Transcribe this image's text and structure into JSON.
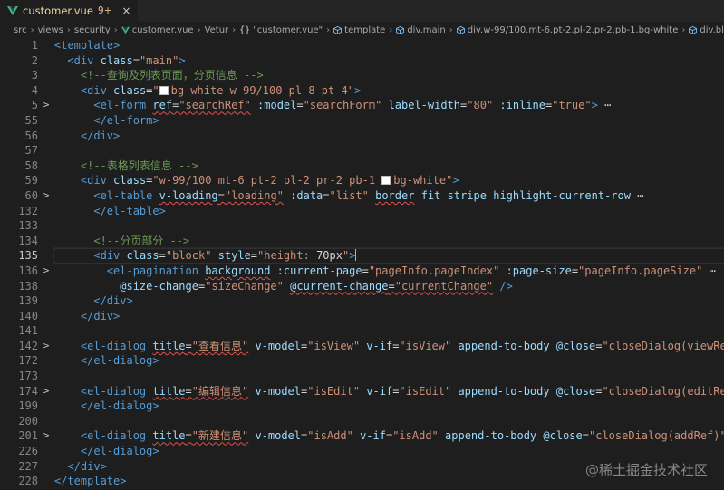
{
  "tab": {
    "filename": "customer.vue",
    "badge": "9+",
    "close": "×"
  },
  "breadcrumb": [
    "src",
    "views",
    "security",
    "customer.vue",
    "Vetur",
    "\"customer.vue\"",
    "template",
    "div.main",
    "div.w-99/100.mt-6.pt-2.pl-2.pr-2.pb-1.bg-white",
    "div.block"
  ],
  "watermark": "@稀土掘金技术社区",
  "lines": [
    {
      "n": "1",
      "fold": "",
      "tokens": [
        [
          "tag",
          "<template>"
        ]
      ]
    },
    {
      "n": "2",
      "fold": "",
      "tokens": [
        [
          "ws",
          "  "
        ],
        [
          "tag",
          "<div"
        ],
        [
          "ws",
          " "
        ],
        [
          "attr",
          "class"
        ],
        [
          "txt",
          "="
        ],
        [
          "str",
          "\"main\""
        ],
        [
          "tag",
          ">"
        ]
      ]
    },
    {
      "n": "3",
      "fold": "",
      "tokens": [
        [
          "ws",
          "    "
        ],
        [
          "cmt",
          "<!--查询及列表页面，分页信息 -->"
        ]
      ]
    },
    {
      "n": "4",
      "fold": "",
      "tokens": [
        [
          "ws",
          "    "
        ],
        [
          "tag",
          "<div"
        ],
        [
          "ws",
          " "
        ],
        [
          "attr",
          "class"
        ],
        [
          "txt",
          "="
        ],
        [
          "str",
          "\""
        ],
        [
          "swatch",
          ""
        ],
        [
          "str",
          "bg-white w-99/100 pl-8 pt-4\""
        ],
        [
          "tag",
          ">"
        ]
      ]
    },
    {
      "n": "5",
      "fold": ">",
      "tokens": [
        [
          "ws",
          "      "
        ],
        [
          "tag",
          "<el-form"
        ],
        [
          "ws",
          " "
        ],
        [
          "attrsq",
          "ref"
        ],
        [
          "txtsq",
          "="
        ],
        [
          "strsq",
          "\"searchRef\""
        ],
        [
          "ws",
          " "
        ],
        [
          "attr",
          ":model"
        ],
        [
          "txt",
          "="
        ],
        [
          "str",
          "\"searchForm\""
        ],
        [
          "ws",
          " "
        ],
        [
          "attr",
          "label-width"
        ],
        [
          "txt",
          "="
        ],
        [
          "str",
          "\"80\""
        ],
        [
          "ws",
          " "
        ],
        [
          "attr",
          ":inline"
        ],
        [
          "txt",
          "="
        ],
        [
          "str",
          "\"true\""
        ],
        [
          "tag",
          ">"
        ],
        [
          "ell",
          " ⋯"
        ]
      ]
    },
    {
      "n": "55",
      "fold": "",
      "tokens": [
        [
          "ws",
          "      "
        ],
        [
          "tag",
          "</el-form>"
        ]
      ]
    },
    {
      "n": "56",
      "fold": "",
      "tokens": [
        [
          "ws",
          "    "
        ],
        [
          "tag",
          "</div>"
        ]
      ]
    },
    {
      "n": "57",
      "fold": "",
      "tokens": []
    },
    {
      "n": "58",
      "fold": "",
      "tokens": [
        [
          "ws",
          "    "
        ],
        [
          "cmt",
          "<!--表格列表信息 -->"
        ]
      ]
    },
    {
      "n": "59",
      "fold": "",
      "tokens": [
        [
          "ws",
          "    "
        ],
        [
          "tag",
          "<div"
        ],
        [
          "ws",
          " "
        ],
        [
          "attr",
          "class"
        ],
        [
          "txt",
          "="
        ],
        [
          "str",
          "\"w-99/100 mt-6 pt-2 pl-2 pr-2 pb-1 "
        ],
        [
          "swatch",
          ""
        ],
        [
          "str",
          "bg-white\""
        ],
        [
          "tag",
          ">"
        ]
      ]
    },
    {
      "n": "60",
      "fold": ">",
      "tokens": [
        [
          "ws",
          "      "
        ],
        [
          "tag",
          "<el-table"
        ],
        [
          "ws",
          " "
        ],
        [
          "attrsq",
          "v-loading"
        ],
        [
          "txtsq",
          "="
        ],
        [
          "strsq",
          "\"loading\""
        ],
        [
          "ws",
          " "
        ],
        [
          "attr",
          ":data"
        ],
        [
          "txt",
          "="
        ],
        [
          "str",
          "\"list\""
        ],
        [
          "ws",
          " "
        ],
        [
          "attrsq",
          "border"
        ],
        [
          "ws",
          " "
        ],
        [
          "attr",
          "fit"
        ],
        [
          "ws",
          " "
        ],
        [
          "attr",
          "stripe"
        ],
        [
          "ws",
          " "
        ],
        [
          "attr",
          "highlight-current-row"
        ],
        [
          "ell",
          " ⋯"
        ]
      ]
    },
    {
      "n": "132",
      "fold": "",
      "tokens": [
        [
          "ws",
          "      "
        ],
        [
          "tag",
          "</el-table>"
        ]
      ]
    },
    {
      "n": "133",
      "fold": "",
      "tokens": []
    },
    {
      "n": "134",
      "fold": "",
      "tokens": [
        [
          "ws",
          "      "
        ],
        [
          "cmt",
          "<!--分页部分 -->"
        ]
      ]
    },
    {
      "n": "135",
      "fold": "",
      "active": true,
      "tokens": [
        [
          "ws",
          "      "
        ],
        [
          "tag",
          "<div"
        ],
        [
          "ws",
          " "
        ],
        [
          "attr",
          "class"
        ],
        [
          "txt",
          "="
        ],
        [
          "str",
          "\"block\""
        ],
        [
          "ws",
          " "
        ],
        [
          "attr",
          "style"
        ],
        [
          "txt",
          "="
        ],
        [
          "str",
          "\"height: "
        ],
        [
          "txt",
          "70px"
        ],
        [
          "str",
          "\""
        ],
        [
          "tag",
          ">"
        ],
        [
          "cursor",
          ""
        ]
      ]
    },
    {
      "n": "136",
      "fold": ">",
      "tokens": [
        [
          "ws",
          "        "
        ],
        [
          "tag",
          "<el-pagination"
        ],
        [
          "ws",
          " "
        ],
        [
          "attrsq",
          "background"
        ],
        [
          "ws",
          " "
        ],
        [
          "attr",
          ":current-page"
        ],
        [
          "txt",
          "="
        ],
        [
          "str",
          "\"pageInfo.pageIndex\""
        ],
        [
          "ws",
          " "
        ],
        [
          "attr",
          ":page-size"
        ],
        [
          "txt",
          "="
        ],
        [
          "str",
          "\"pageInfo.pageSize\""
        ],
        [
          "ell",
          " ⋯"
        ]
      ]
    },
    {
      "n": "138",
      "fold": "",
      "tokens": [
        [
          "ws",
          "          "
        ],
        [
          "attr",
          "@size-change"
        ],
        [
          "txt",
          "="
        ],
        [
          "str",
          "\"sizeChange\""
        ],
        [
          "ws",
          " "
        ],
        [
          "attrsq",
          "@current-change"
        ],
        [
          "txtsq",
          "="
        ],
        [
          "strsq",
          "\"currentChange\""
        ],
        [
          "ws",
          " "
        ],
        [
          "tag",
          "/>"
        ]
      ]
    },
    {
      "n": "139",
      "fold": "",
      "tokens": [
        [
          "ws",
          "      "
        ],
        [
          "tag",
          "</div>"
        ]
      ]
    },
    {
      "n": "140",
      "fold": "",
      "tokens": [
        [
          "ws",
          "    "
        ],
        [
          "tag",
          "</div>"
        ]
      ]
    },
    {
      "n": "141",
      "fold": "",
      "tokens": []
    },
    {
      "n": "142",
      "fold": ">",
      "tokens": [
        [
          "ws",
          "    "
        ],
        [
          "tag",
          "<el-dialog"
        ],
        [
          "ws",
          " "
        ],
        [
          "attrsq",
          "title"
        ],
        [
          "txtsq",
          "="
        ],
        [
          "strsq",
          "\"查看信息\""
        ],
        [
          "ws",
          " "
        ],
        [
          "attr",
          "v-model"
        ],
        [
          "txt",
          "="
        ],
        [
          "str",
          "\"isView\""
        ],
        [
          "ws",
          " "
        ],
        [
          "attr",
          "v-if"
        ],
        [
          "txt",
          "="
        ],
        [
          "str",
          "\"isView\""
        ],
        [
          "ws",
          " "
        ],
        [
          "attr",
          "append-to-body"
        ],
        [
          "ws",
          " "
        ],
        [
          "attr",
          "@close"
        ],
        [
          "txt",
          "="
        ],
        [
          "str",
          "\"closeDialog(viewRef)\""
        ],
        [
          "tag",
          ">"
        ]
      ]
    },
    {
      "n": "172",
      "fold": "",
      "tokens": [
        [
          "ws",
          "    "
        ],
        [
          "tag",
          "</el-dialog>"
        ]
      ]
    },
    {
      "n": "173",
      "fold": "",
      "tokens": []
    },
    {
      "n": "174",
      "fold": ">",
      "tokens": [
        [
          "ws",
          "    "
        ],
        [
          "tag",
          "<el-dialog"
        ],
        [
          "ws",
          " "
        ],
        [
          "attrsq",
          "title"
        ],
        [
          "txtsq",
          "="
        ],
        [
          "strsq",
          "\"编辑信息\""
        ],
        [
          "ws",
          " "
        ],
        [
          "attr",
          "v-model"
        ],
        [
          "txt",
          "="
        ],
        [
          "str",
          "\"isEdit\""
        ],
        [
          "ws",
          " "
        ],
        [
          "attr",
          "v-if"
        ],
        [
          "txt",
          "="
        ],
        [
          "str",
          "\"isEdit\""
        ],
        [
          "ws",
          " "
        ],
        [
          "attr",
          "append-to-body"
        ],
        [
          "ws",
          " "
        ],
        [
          "attr",
          "@close"
        ],
        [
          "txt",
          "="
        ],
        [
          "str",
          "\"closeDialog(editRef)\""
        ],
        [
          "tag",
          ">"
        ]
      ]
    },
    {
      "n": "199",
      "fold": "",
      "tokens": [
        [
          "ws",
          "    "
        ],
        [
          "tag",
          "</el-dialog>"
        ]
      ]
    },
    {
      "n": "200",
      "fold": "",
      "tokens": []
    },
    {
      "n": "201",
      "fold": ">",
      "tokens": [
        [
          "ws",
          "    "
        ],
        [
          "tag",
          "<el-dialog"
        ],
        [
          "ws",
          " "
        ],
        [
          "attrsq",
          "title"
        ],
        [
          "txtsq",
          "="
        ],
        [
          "strsq",
          "\"新建信息\""
        ],
        [
          "ws",
          " "
        ],
        [
          "attr",
          "v-model"
        ],
        [
          "txt",
          "="
        ],
        [
          "str",
          "\"isAdd\""
        ],
        [
          "ws",
          " "
        ],
        [
          "attr",
          "v-if"
        ],
        [
          "txt",
          "="
        ],
        [
          "str",
          "\"isAdd\""
        ],
        [
          "ws",
          " "
        ],
        [
          "attr",
          "append-to-body"
        ],
        [
          "ws",
          " "
        ],
        [
          "attr",
          "@close"
        ],
        [
          "txt",
          "="
        ],
        [
          "str",
          "\"closeDialog(addRef)\""
        ],
        [
          "tag",
          ">"
        ],
        [
          "ell",
          " ⋯"
        ]
      ]
    },
    {
      "n": "226",
      "fold": "",
      "tokens": [
        [
          "ws",
          "    "
        ],
        [
          "tag",
          "</el-dialog>"
        ]
      ]
    },
    {
      "n": "227",
      "fold": "",
      "tokens": [
        [
          "ws",
          "  "
        ],
        [
          "tag",
          "</div>"
        ]
      ]
    },
    {
      "n": "228",
      "fold": "",
      "tokens": [
        [
          "tag",
          "</template>"
        ]
      ]
    }
  ]
}
